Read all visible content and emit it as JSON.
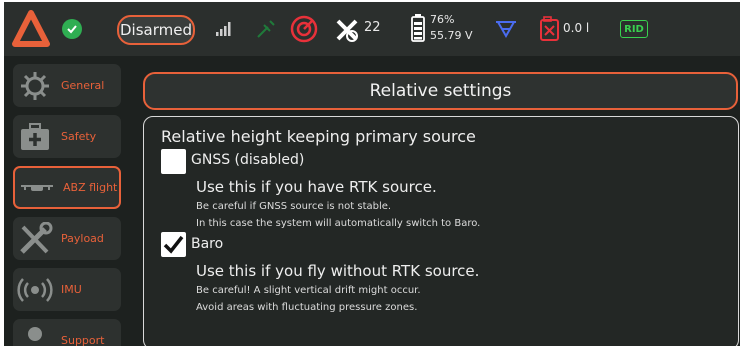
{
  "topbar": {
    "arm_state": "Disarmed",
    "satellites": "22",
    "battery_percent": "76%",
    "battery_voltage": "55.79 V",
    "fuel": "0.0 l",
    "rid_label": "RID",
    "icons": [
      "app-logo-icon",
      "status-ok-icon",
      "signal-icon",
      "rc-link-icon",
      "target-icon",
      "satellite-icon",
      "battery-icon",
      "network-icon",
      "fuel-tank-icon"
    ]
  },
  "sidebar": {
    "items": [
      {
        "label": "General",
        "icon": "gear-icon",
        "active": false
      },
      {
        "label": "Safety",
        "icon": "first-aid-icon",
        "active": false
      },
      {
        "label": "ABZ flight",
        "icon": "drone-icon",
        "active": true
      },
      {
        "label": "Payload",
        "icon": "tools-icon",
        "active": false
      },
      {
        "label": "IMU",
        "icon": "broadcast-icon",
        "active": false
      },
      {
        "label": "Support",
        "icon": "support-icon",
        "active": false
      }
    ]
  },
  "main": {
    "header": "Relative settings",
    "section_title": "Relative height keeping primary source",
    "options": [
      {
        "label": "GNSS (disabled)",
        "checked": false,
        "headline": "Use this if you have RTK source.",
        "note1": "Be careful if GNSS source is not stable.",
        "note2": "In this case the system will automatically switch to Baro."
      },
      {
        "label": "Baro",
        "checked": true,
        "headline": "Use this if you fly without RTK source.",
        "note1": "Be careful! A slight vertical drift might occur.",
        "note2": "Avoid areas with fluctuating pressure zones."
      }
    ]
  },
  "colors": {
    "accent": "#e8613a",
    "background": "#1d211f",
    "ok_green": "#2fae52",
    "rid_green": "#39d04f",
    "alert_red": "#e8313a",
    "network_blue": "#4a6cf0"
  }
}
